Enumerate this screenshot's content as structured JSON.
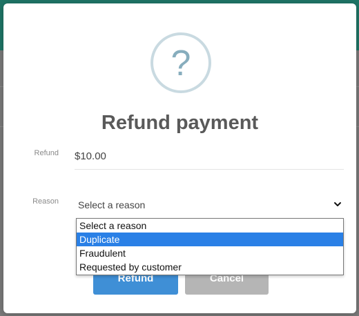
{
  "dialog": {
    "icon": "question-mark-icon",
    "icon_glyph": "?",
    "title": "Refund payment"
  },
  "form": {
    "refund_label": "Refund",
    "refund_amount": "$10.00",
    "reason_label": "Reason",
    "reason_selected": "Select a reason"
  },
  "dropdown": {
    "options": [
      {
        "label": "Select a reason",
        "highlighted": false
      },
      {
        "label": "Duplicate",
        "highlighted": true
      },
      {
        "label": "Fraudulent",
        "highlighted": false
      },
      {
        "label": "Requested by customer",
        "highlighted": false
      }
    ]
  },
  "buttons": {
    "refund_label": "Refund",
    "cancel_label": "Cancel"
  },
  "colors": {
    "primary_button": "#3f8fd6",
    "secondary_button": "#b5b5b5",
    "highlight": "#2a80e6",
    "header": "#1f7566"
  }
}
